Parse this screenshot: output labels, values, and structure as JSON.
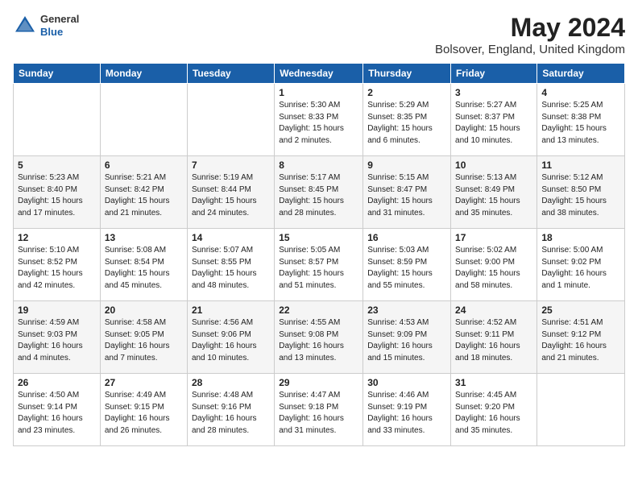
{
  "header": {
    "logo_general": "General",
    "logo_blue": "Blue",
    "month": "May 2024",
    "location": "Bolsover, England, United Kingdom"
  },
  "days_of_week": [
    "Sunday",
    "Monday",
    "Tuesday",
    "Wednesday",
    "Thursday",
    "Friday",
    "Saturday"
  ],
  "weeks": [
    [
      {
        "day": "",
        "info": ""
      },
      {
        "day": "",
        "info": ""
      },
      {
        "day": "",
        "info": ""
      },
      {
        "day": "1",
        "info": "Sunrise: 5:30 AM\nSunset: 8:33 PM\nDaylight: 15 hours\nand 2 minutes."
      },
      {
        "day": "2",
        "info": "Sunrise: 5:29 AM\nSunset: 8:35 PM\nDaylight: 15 hours\nand 6 minutes."
      },
      {
        "day": "3",
        "info": "Sunrise: 5:27 AM\nSunset: 8:37 PM\nDaylight: 15 hours\nand 10 minutes."
      },
      {
        "day": "4",
        "info": "Sunrise: 5:25 AM\nSunset: 8:38 PM\nDaylight: 15 hours\nand 13 minutes."
      }
    ],
    [
      {
        "day": "5",
        "info": "Sunrise: 5:23 AM\nSunset: 8:40 PM\nDaylight: 15 hours\nand 17 minutes."
      },
      {
        "day": "6",
        "info": "Sunrise: 5:21 AM\nSunset: 8:42 PM\nDaylight: 15 hours\nand 21 minutes."
      },
      {
        "day": "7",
        "info": "Sunrise: 5:19 AM\nSunset: 8:44 PM\nDaylight: 15 hours\nand 24 minutes."
      },
      {
        "day": "8",
        "info": "Sunrise: 5:17 AM\nSunset: 8:45 PM\nDaylight: 15 hours\nand 28 minutes."
      },
      {
        "day": "9",
        "info": "Sunrise: 5:15 AM\nSunset: 8:47 PM\nDaylight: 15 hours\nand 31 minutes."
      },
      {
        "day": "10",
        "info": "Sunrise: 5:13 AM\nSunset: 8:49 PM\nDaylight: 15 hours\nand 35 minutes."
      },
      {
        "day": "11",
        "info": "Sunrise: 5:12 AM\nSunset: 8:50 PM\nDaylight: 15 hours\nand 38 minutes."
      }
    ],
    [
      {
        "day": "12",
        "info": "Sunrise: 5:10 AM\nSunset: 8:52 PM\nDaylight: 15 hours\nand 42 minutes."
      },
      {
        "day": "13",
        "info": "Sunrise: 5:08 AM\nSunset: 8:54 PM\nDaylight: 15 hours\nand 45 minutes."
      },
      {
        "day": "14",
        "info": "Sunrise: 5:07 AM\nSunset: 8:55 PM\nDaylight: 15 hours\nand 48 minutes."
      },
      {
        "day": "15",
        "info": "Sunrise: 5:05 AM\nSunset: 8:57 PM\nDaylight: 15 hours\nand 51 minutes."
      },
      {
        "day": "16",
        "info": "Sunrise: 5:03 AM\nSunset: 8:59 PM\nDaylight: 15 hours\nand 55 minutes."
      },
      {
        "day": "17",
        "info": "Sunrise: 5:02 AM\nSunset: 9:00 PM\nDaylight: 15 hours\nand 58 minutes."
      },
      {
        "day": "18",
        "info": "Sunrise: 5:00 AM\nSunset: 9:02 PM\nDaylight: 16 hours\nand 1 minute."
      }
    ],
    [
      {
        "day": "19",
        "info": "Sunrise: 4:59 AM\nSunset: 9:03 PM\nDaylight: 16 hours\nand 4 minutes."
      },
      {
        "day": "20",
        "info": "Sunrise: 4:58 AM\nSunset: 9:05 PM\nDaylight: 16 hours\nand 7 minutes."
      },
      {
        "day": "21",
        "info": "Sunrise: 4:56 AM\nSunset: 9:06 PM\nDaylight: 16 hours\nand 10 minutes."
      },
      {
        "day": "22",
        "info": "Sunrise: 4:55 AM\nSunset: 9:08 PM\nDaylight: 16 hours\nand 13 minutes."
      },
      {
        "day": "23",
        "info": "Sunrise: 4:53 AM\nSunset: 9:09 PM\nDaylight: 16 hours\nand 15 minutes."
      },
      {
        "day": "24",
        "info": "Sunrise: 4:52 AM\nSunset: 9:11 PM\nDaylight: 16 hours\nand 18 minutes."
      },
      {
        "day": "25",
        "info": "Sunrise: 4:51 AM\nSunset: 9:12 PM\nDaylight: 16 hours\nand 21 minutes."
      }
    ],
    [
      {
        "day": "26",
        "info": "Sunrise: 4:50 AM\nSunset: 9:14 PM\nDaylight: 16 hours\nand 23 minutes."
      },
      {
        "day": "27",
        "info": "Sunrise: 4:49 AM\nSunset: 9:15 PM\nDaylight: 16 hours\nand 26 minutes."
      },
      {
        "day": "28",
        "info": "Sunrise: 4:48 AM\nSunset: 9:16 PM\nDaylight: 16 hours\nand 28 minutes."
      },
      {
        "day": "29",
        "info": "Sunrise: 4:47 AM\nSunset: 9:18 PM\nDaylight: 16 hours\nand 31 minutes."
      },
      {
        "day": "30",
        "info": "Sunrise: 4:46 AM\nSunset: 9:19 PM\nDaylight: 16 hours\nand 33 minutes."
      },
      {
        "day": "31",
        "info": "Sunrise: 4:45 AM\nSunset: 9:20 PM\nDaylight: 16 hours\nand 35 minutes."
      },
      {
        "day": "",
        "info": ""
      }
    ]
  ]
}
